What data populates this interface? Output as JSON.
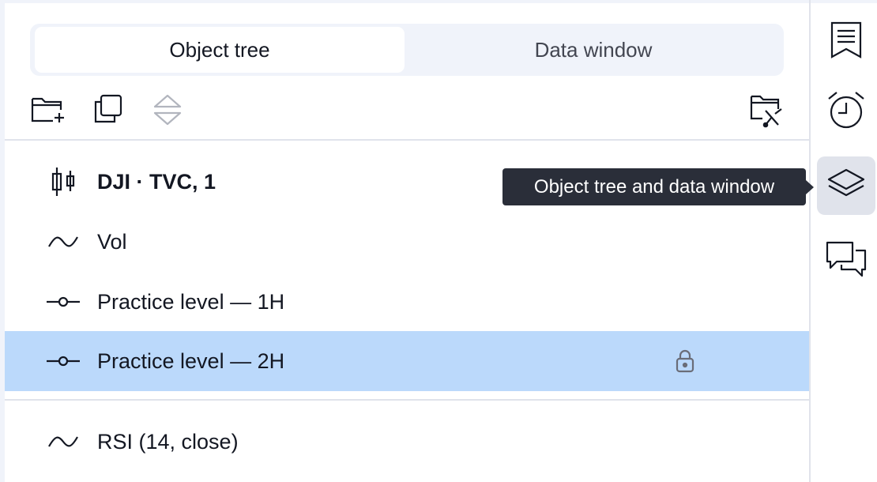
{
  "tabs": [
    {
      "label": "Object tree",
      "active": true
    },
    {
      "label": "Data window",
      "active": false
    }
  ],
  "toolbar": {
    "icons": [
      "new-folder-icon",
      "duplicate-icon",
      "reorder-icon",
      "manage-folders-icon"
    ]
  },
  "tree": {
    "items": [
      {
        "label": "DJI · TVC, 1",
        "icon": "candlestick-icon",
        "bold": true
      },
      {
        "label": "Vol",
        "icon": "indicator-wave-icon"
      },
      {
        "label": "Practice level — 1H",
        "icon": "horizontal-line-icon"
      },
      {
        "label": "Practice level — 2H",
        "icon": "horizontal-line-icon",
        "selected": true,
        "locked": true
      },
      {
        "label": "RSI (14, close)",
        "icon": "indicator-wave-icon"
      }
    ]
  },
  "tooltip": {
    "text": "Object tree and data window"
  },
  "sidebar": {
    "buttons": [
      {
        "name": "watchlist-icon"
      },
      {
        "name": "alarm-clock-icon"
      },
      {
        "name": "layers-icon",
        "active": true
      },
      {
        "name": "chat-icon"
      }
    ]
  },
  "colors": {
    "selected_row": "#bbd9fb",
    "tooltip_bg": "#2a2e39",
    "segment_bg": "#f0f3fa"
  }
}
